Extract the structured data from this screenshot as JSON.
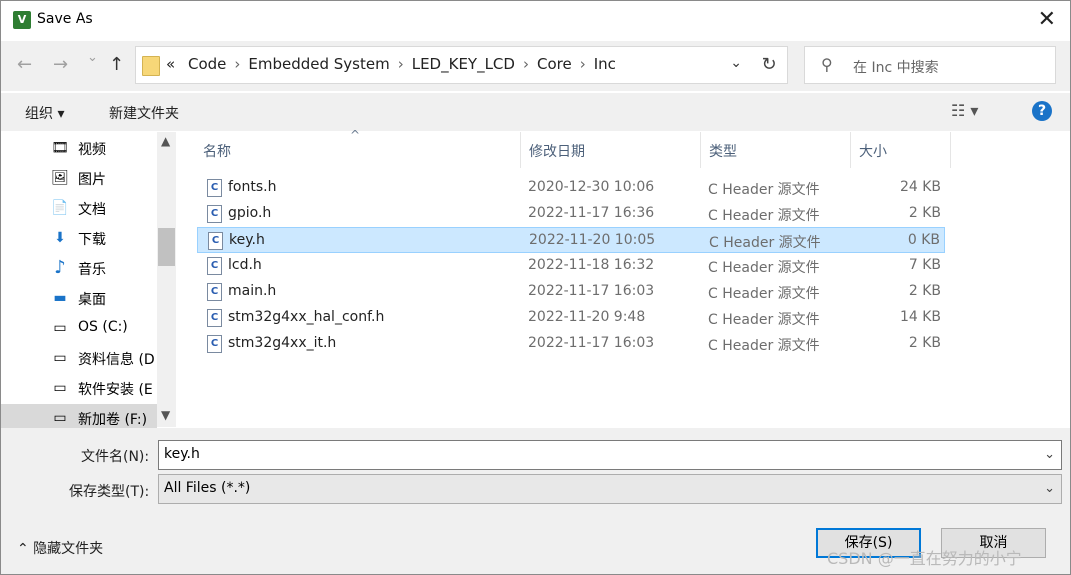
{
  "window": {
    "title": "Save As",
    "close_glyph": "✕"
  },
  "nav": {
    "back_glyph": "←",
    "forward_glyph": "→",
    "recent_glyph": "⌄",
    "up_glyph": "↑",
    "breadcrumb_prefix": "«",
    "breadcrumbs": [
      "Code",
      "Embedded System",
      "LED_KEY_LCD",
      "Core",
      "Inc"
    ],
    "separator": "›",
    "dropdown_glyph": "⌄",
    "refresh_glyph": "↻",
    "search_icon_glyph": "⚲",
    "search_placeholder": "在 Inc 中搜索"
  },
  "toolbar": {
    "organize_label": "组织 ▾",
    "new_folder_label": "新建文件夹",
    "view_glyph": "☷ ▾",
    "help_glyph": "?"
  },
  "sidebar": {
    "items": [
      {
        "label": "视频",
        "icon": "video-icon",
        "glyph": "🎞"
      },
      {
        "label": "图片",
        "icon": "pictures-icon",
        "glyph": "🖼"
      },
      {
        "label": "文档",
        "icon": "documents-icon",
        "glyph": "📄"
      },
      {
        "label": "下载",
        "icon": "downloads-icon",
        "glyph": "⬇"
      },
      {
        "label": "音乐",
        "icon": "music-icon",
        "glyph": "♪"
      },
      {
        "label": "桌面",
        "icon": "desktop-icon",
        "glyph": "▬"
      },
      {
        "label": "OS (C:)",
        "icon": "os-drive-icon",
        "glyph": "▭"
      },
      {
        "label": "资料信息 (D",
        "icon": "drive-icon",
        "glyph": "▭"
      },
      {
        "label": "软件安装 (E",
        "icon": "drive-icon",
        "glyph": "▭"
      },
      {
        "label": "新加卷 (F:)",
        "icon": "drive-icon",
        "glyph": "▭"
      }
    ],
    "selected_index": 9
  },
  "columns": {
    "name": "名称",
    "date": "修改日期",
    "type": "类型",
    "size": "大小",
    "sort_glyph": "^"
  },
  "files": [
    {
      "name": "fonts.h",
      "date": "2020-12-30 10:06",
      "type": "C Header 源文件",
      "size": "24 KB"
    },
    {
      "name": "gpio.h",
      "date": "2022-11-17 16:36",
      "type": "C Header 源文件",
      "size": "2 KB"
    },
    {
      "name": "key.h",
      "date": "2022-11-20 10:05",
      "type": "C Header 源文件",
      "size": "0 KB"
    },
    {
      "name": "lcd.h",
      "date": "2022-11-18 16:32",
      "type": "C Header 源文件",
      "size": "7 KB"
    },
    {
      "name": "main.h",
      "date": "2022-11-17 16:03",
      "type": "C Header 源文件",
      "size": "2 KB"
    },
    {
      "name": "stm32g4xx_hal_conf.h",
      "date": "2022-11-20 9:48",
      "type": "C Header 源文件",
      "size": "14 KB"
    },
    {
      "name": "stm32g4xx_it.h",
      "date": "2022-11-17 16:03",
      "type": "C Header 源文件",
      "size": "2 KB"
    }
  ],
  "selected_file_index": 2,
  "form": {
    "filename_label": "文件名(N):",
    "filename_value": "key.h",
    "filetype_label": "保存类型(T):",
    "filetype_value": "All Files (*.*)",
    "chevron_glyph": "⌄"
  },
  "footer": {
    "hide_folders_label": "⌃ 隐藏文件夹",
    "save_label": "保存(S)",
    "cancel_label": "取消",
    "watermark": "CSDN @一直在努力的小宁"
  },
  "colors": {
    "selection_bg": "#cce8ff",
    "selection_border": "#99d1ff",
    "accent": "#0078d7"
  }
}
